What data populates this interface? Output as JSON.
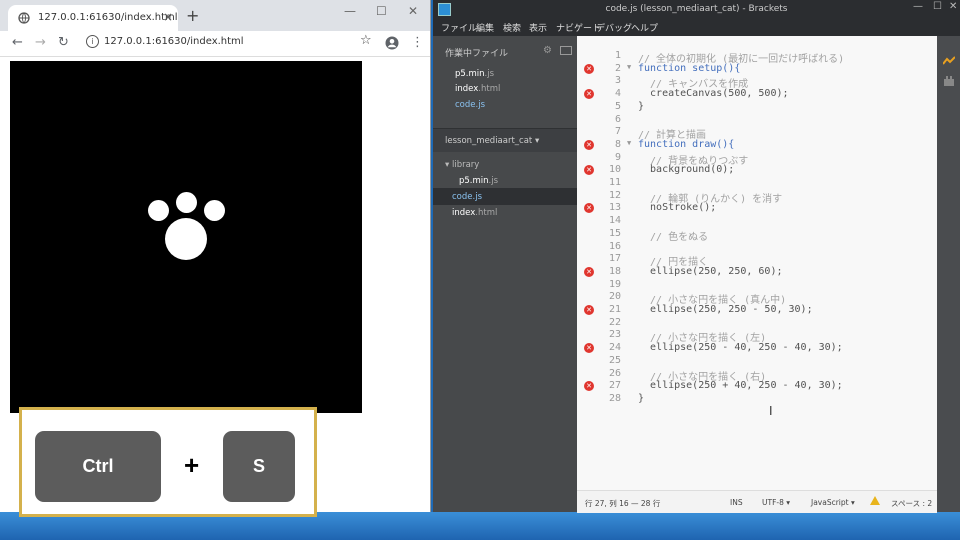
{
  "chrome": {
    "tab_title": "127.0.0.1:61630/index.html",
    "tab_close": "×",
    "new_tab": "+",
    "url": "127.0.0.1:61630/index.html",
    "btn_min": "—",
    "btn_max": "☐",
    "btn_close": "✕",
    "back": "←",
    "forward": "→",
    "reload": "↻",
    "info": "i",
    "star": "☆",
    "menu": "⋮"
  },
  "shortcut": {
    "key1": "Ctrl",
    "plus": "+",
    "key2": "S"
  },
  "brackets": {
    "title": "code.js (lesson_mediaart_cat) - Brackets",
    "menu": [
      "ファイル",
      "編集",
      "検索",
      "表示",
      "ナビゲート",
      "デバッグ",
      "ヘルプ"
    ],
    "working_files_header": "作業中ファイル",
    "working_files": [
      {
        "name": "p5.min",
        "ext": ".js"
      },
      {
        "name": "index",
        "ext": ".html"
      },
      {
        "name": "code",
        "ext": ".js"
      }
    ],
    "project": "lesson_mediaart_cat ▾",
    "tree": [
      {
        "label": "▾ library"
      },
      {
        "name": "p5.min",
        "ext": ".js"
      },
      {
        "name": "code",
        "ext": ".js"
      },
      {
        "name": "index",
        "ext": ".html"
      }
    ]
  },
  "code_lines": [
    {
      "n": "1",
      "text": "// 全体の初期化 (最初に一回だけ呼ばれる)"
    },
    {
      "n": "2",
      "text": "function setup(){"
    },
    {
      "n": "3",
      "text": "  // キャンバスを作成"
    },
    {
      "n": "4",
      "text": "  createCanvas(500, 500);"
    },
    {
      "n": "5",
      "text": "}"
    },
    {
      "n": "6",
      "text": ""
    },
    {
      "n": "7",
      "text": "// 計算と描画"
    },
    {
      "n": "8",
      "text": "function draw(){"
    },
    {
      "n": "9",
      "text": "  // 背景をぬりつぶす"
    },
    {
      "n": "10",
      "text": "  background(0);"
    },
    {
      "n": "11",
      "text": ""
    },
    {
      "n": "12",
      "text": "  // 輪郭 (りんかく) を消す"
    },
    {
      "n": "13",
      "text": "  noStroke();"
    },
    {
      "n": "14",
      "text": ""
    },
    {
      "n": "15",
      "text": "  // 色をぬる"
    },
    {
      "n": "16",
      "text": ""
    },
    {
      "n": "17",
      "text": "  // 円を描く"
    },
    {
      "n": "18",
      "text": "  ellipse(250, 250, 60);"
    },
    {
      "n": "19",
      "text": ""
    },
    {
      "n": "20",
      "text": "  // 小さな円を描く (真ん中)"
    },
    {
      "n": "21",
      "text": "  ellipse(250, 250 - 50, 30);"
    },
    {
      "n": "22",
      "text": ""
    },
    {
      "n": "23",
      "text": "  // 小さな円を描く (左)"
    },
    {
      "n": "24",
      "text": "  ellipse(250 - 40, 250 - 40, 30);"
    },
    {
      "n": "25",
      "text": ""
    },
    {
      "n": "26",
      "text": "  // 小さな円を描く (右)"
    },
    {
      "n": "27",
      "text": "  ellipse(250 + 40, 250 - 40, 30);"
    },
    {
      "n": "28",
      "text": "}"
    }
  ],
  "error_lines": [
    "2",
    "4",
    "8",
    "10",
    "13",
    "18",
    "21",
    "24",
    "27"
  ],
  "status": {
    "position": "行 27, 列 16 — 28 行",
    "mode": "INS",
    "encoding": "UTF-8 ▾",
    "language": "JavaScript ▾",
    "spaces": "スペース : 2"
  },
  "colors": {
    "error": "#e0362f",
    "keyword": "#446fbd",
    "frame": "#d4b14c"
  }
}
